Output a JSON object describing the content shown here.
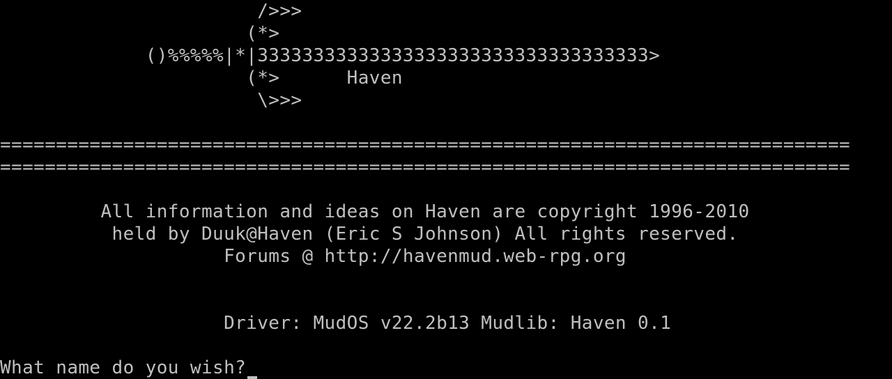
{
  "colors": {
    "background": "#000000",
    "foreground": "#c0c0c0"
  },
  "banner": {
    "art_line_1": "                       />>>",
    "art_line_2": "                      (*>",
    "art_line_3": "             ()%%%%%|*|33333333333333333333333333333333333>",
    "art_line_4": "                      (*>      Haven",
    "art_line_5": "                       \\>>>"
  },
  "separators": {
    "line_1": "============================================================================",
    "line_2": "============================================================================"
  },
  "copyright": {
    "line_1": "         All information and ideas on Haven are copyright 1996-2010",
    "line_2": "          held by Duuk@Haven (Eric S Johnson) All rights reserved.",
    "line_3": "                    Forums @ http://havenmud.web-rpg.org"
  },
  "driver": {
    "line": "                    Driver: MudOS v22.2b13 Mudlib: Haven 0.1"
  },
  "prompt": {
    "text": "What name do you wish?"
  }
}
